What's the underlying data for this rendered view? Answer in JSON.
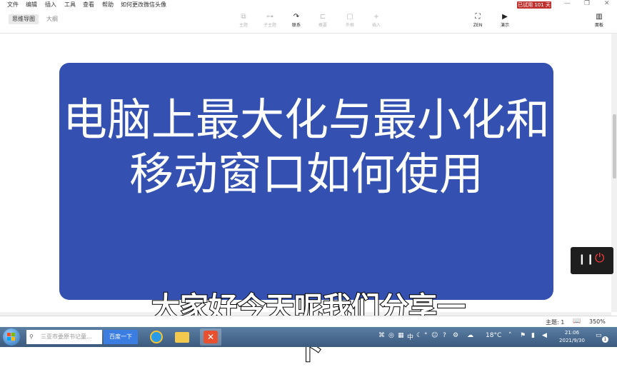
{
  "menu": {
    "items": [
      "文件",
      "编辑",
      "插入",
      "工具",
      "查看",
      "帮助"
    ],
    "doc_title": "如何更改微信头像"
  },
  "trial_badge": "已试用 101 天",
  "window_controls": {
    "minimize": "—",
    "restore": "❐",
    "close": "✕"
  },
  "view_tabs": [
    "思维导图",
    "大纲"
  ],
  "toolbar": {
    "topic": "主题",
    "subtopic": "子主题",
    "relationship": "联系",
    "summary": "概要",
    "boundary": "外框",
    "insert": "插入",
    "zen": "ZEN",
    "present": "演示",
    "panel": "面板"
  },
  "card": {
    "title": "电脑上最大化与最小化和移动窗口如何使用",
    "color": "#3451b2"
  },
  "subtitle": "大家好今天呢我们分享一下",
  "statusbar": {
    "topic_count": "主题: 1",
    "zoom": "350%"
  },
  "taskbar": {
    "search_placeholder": "三亚市委原书记童...",
    "search_button": "百度一下",
    "weather": "18°C",
    "ime_label": "中",
    "time": "21:06",
    "date": "2021/9/30",
    "notification_count": "1"
  }
}
